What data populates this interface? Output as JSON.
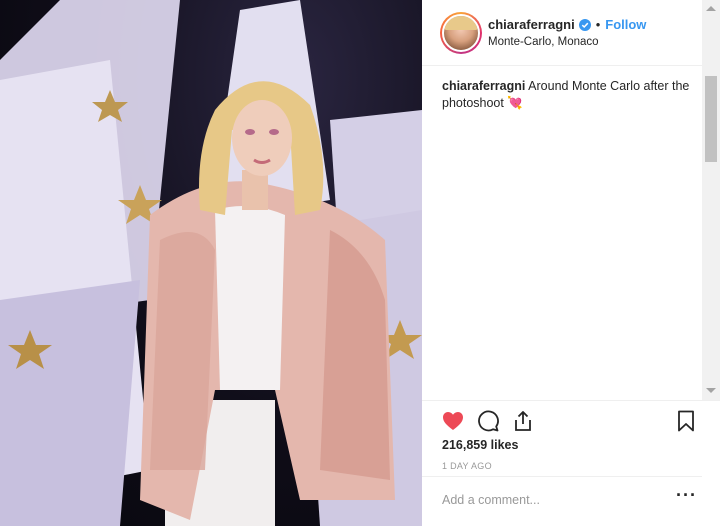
{
  "post": {
    "photo_icon": "photo-of-woman-in-pink-fur-coat",
    "header": {
      "username": "chiaraferragni",
      "verified_icon": "verified-badge-icon",
      "separator": "•",
      "follow_label": "Follow",
      "location": "Monte-Carlo, Monaco"
    },
    "caption": {
      "username": "chiaraferragni",
      "text": "Around Monte Carlo after the photoshoot 💘"
    },
    "actions": {
      "like_icon": "heart-icon",
      "comment_icon": "comment-icon",
      "share_icon": "share-icon",
      "save_icon": "bookmark-icon"
    },
    "likes_text": "216,859 likes",
    "time_ago": "1 DAY AGO",
    "comment": {
      "placeholder": "Add a comment...",
      "more_label": "···"
    }
  },
  "colors": {
    "accent": "#3897f0",
    "like": "#ed4956",
    "muted": "#999999"
  }
}
